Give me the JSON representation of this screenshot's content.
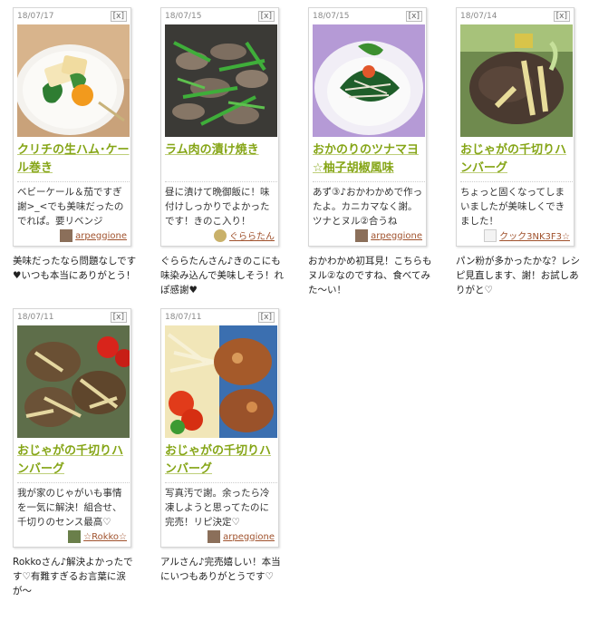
{
  "colors": {
    "title": "#85a516",
    "author": "#a0522d",
    "border": "#d6d6d6"
  },
  "close_label": "[x]",
  "cards": [
    {
      "date": "18/07/17",
      "title": "クリチの生ハム･ケール巻き",
      "message": "ベビーケール＆茄ですぎ謝>_<でも美味だったのでれぱ。要リベンジ",
      "author": "arpeggione",
      "reply": "美味だったなら問題なしです♥いつも本当にありがとう！"
    },
    {
      "date": "18/07/15",
      "title": "ラム肉の漬け焼き",
      "message": "昼に漬けて晩御飯に！味付けしっかりでよかったです！きのこ入り！",
      "author": "ぐららたん",
      "reply": "ぐららたんさん♪きのこにも味染み込んで美味しそう！れぽ感謝♥"
    },
    {
      "date": "18/07/15",
      "title": "おかのりのツナマヨ☆柚子胡椒風味",
      "message": "あず③♪おかわかめで作ったよ。カニカマなく謝。ツナとヌル②合うね",
      "author": "arpeggione",
      "reply": "おかわかめ初耳見！こちらもヌル②なのですね、食べてみた〜い！"
    },
    {
      "date": "18/07/14",
      "title": "おじゃがの千切りハンバーグ",
      "message": "ちょっと固くなってしまいましたが美味しくできました！",
      "author": "クック3NK3F3☆",
      "reply": "パン粉が多かったかな？レシピ見直します、謝！お試しありがと♡"
    },
    {
      "date": "18/07/11",
      "title": "おじゃがの千切りハンバーグ",
      "message": "我が家のじゃがいも事情を一気に解決！組合せ、千切りのセンス最高♡",
      "author": "☆Rokko☆",
      "reply": "Rokkoさん♪解決よかったです♡有難すぎるお言葉に涙が〜"
    },
    {
      "date": "18/07/11",
      "title": "おじゃがの千切りハンバーグ",
      "message": "写真汚で謝。余ったら冷凍しようと思ってたのに完売！リピ決定♡",
      "author": "arpeggione",
      "reply": "アルさん♪完売嬉しい！本当にいつもありがとうです♡"
    }
  ]
}
